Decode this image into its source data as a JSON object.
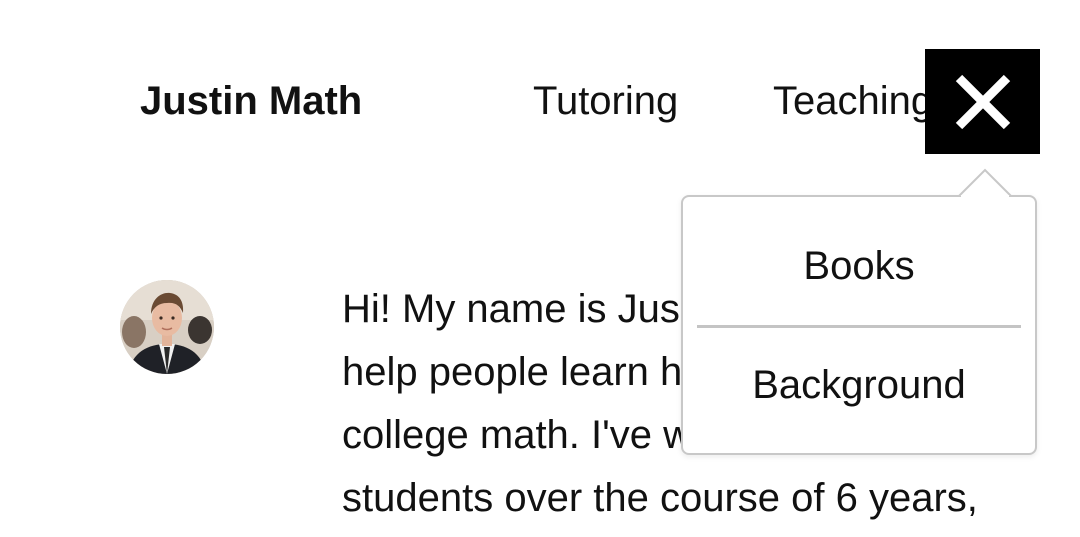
{
  "header": {
    "brand": "Justin Math",
    "nav": {
      "tutoring": "Tutoring",
      "teaching": "Teaching"
    },
    "menu_toggle_icon": "close-icon"
  },
  "dropdown": {
    "items": [
      {
        "label": "Books"
      },
      {
        "label": "Background"
      }
    ]
  },
  "intro": {
    "avatar_icon": "profile-photo",
    "lines": [
      "Hi! My name is Jus",
      "help people learn h",
      "college math. I've w",
      "students over the course of 6 years,"
    ]
  },
  "colors": {
    "menu_toggle_bg": "#000000",
    "text": "#111111",
    "divider": "#c4c4c4",
    "dropdown_border": "#c8c8c8"
  }
}
